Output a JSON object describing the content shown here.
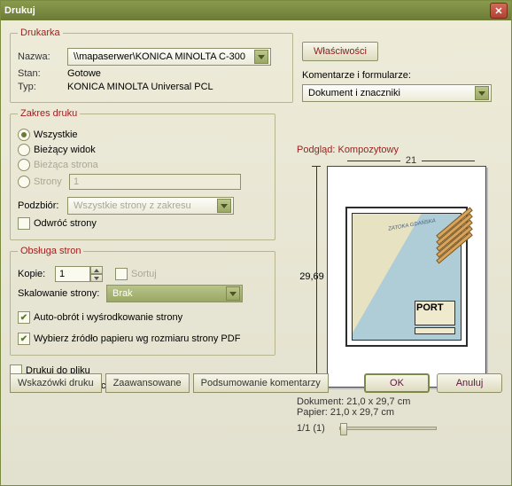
{
  "titlebar": {
    "title": "Drukuj"
  },
  "printer": {
    "legend": "Drukarka",
    "name_label": "Nazwa:",
    "name_value": "\\\\mapaserwer\\KONICA MINOLTA C-300",
    "state_label": "Stan:",
    "state_value": "Gotowe",
    "type_label": "Typ:",
    "type_value": "KONICA MINOLTA Universal PCL",
    "properties_btn": "Właściwości",
    "comments_label": "Komentarze i formularze:",
    "comments_value": "Dokument i znaczniki"
  },
  "range": {
    "legend": "Zakres druku",
    "all": "Wszystkie",
    "view": "Bieżący widok",
    "page": "Bieżąca strona",
    "pages": "Strony",
    "pages_value": "1",
    "subset_label": "Podzbiór:",
    "subset_value": "Wszystkie strony z zakresu",
    "reverse": "Odwróć strony"
  },
  "pages": {
    "legend": "Obsługa stron",
    "copies_label": "Kopie:",
    "copies_value": "1",
    "collate": "Sortuj",
    "scale_label": "Skalowanie strony:",
    "scale_value": "Brak",
    "auto": "Auto-obrót i wyśrodkowanie strony",
    "paper_src": "Wybierz źródło papieru wg rozmiaru strony PDF"
  },
  "extras": {
    "to_file": "Drukuj do pliku",
    "as_black": "Drukuj kolor jako czarny"
  },
  "preview": {
    "title": "Podgląd: Kompozytowy",
    "width": "21",
    "height": "29,69",
    "chart_top": "",
    "chart_sea": "ZATOKA GDAŃSKA",
    "chart_box_title": "PORT",
    "doc_label": "Dokument: 21,0 x 29,7 cm",
    "paper_label": "Papier: 21,0 x 29,7 cm",
    "page_label": "1/1 (1)"
  },
  "footer": {
    "tips": "Wskazówki druku",
    "advanced": "Zaawansowane",
    "summary": "Podsumowanie komentarzy",
    "ok": "OK",
    "cancel": "Anuluj"
  }
}
